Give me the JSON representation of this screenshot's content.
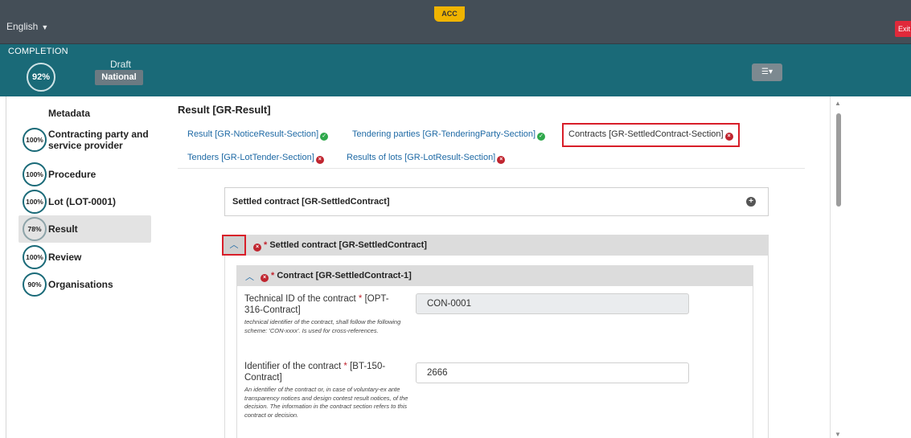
{
  "topbar": {
    "language": "English",
    "env_badge": "ACC",
    "exit_label": "Exit"
  },
  "completion": {
    "label": "COMPLETION",
    "percent": "92%",
    "status": "Draft",
    "scope": "National"
  },
  "sidebar": {
    "metadata": "Metadata",
    "items": [
      {
        "percent": "100%",
        "label": "Contracting party and service provider"
      },
      {
        "percent": "100%",
        "label": "Procedure"
      },
      {
        "percent": "100%",
        "label": "Lot (LOT-0001)"
      },
      {
        "percent": "78%",
        "label": "Result",
        "active": true
      },
      {
        "percent": "100%",
        "label": "Review"
      },
      {
        "percent": "90%",
        "label": "Organisations"
      }
    ]
  },
  "main": {
    "title": "Result [GR-Result]",
    "sections": [
      {
        "label": "Result  [GR-NoticeResult-Section]",
        "status": "ok"
      },
      {
        "label": "Tendering parties  [GR-TenderingParty-Section]",
        "status": "ok"
      },
      {
        "label": "Contracts  [GR-SettledContract-Section]",
        "status": "error"
      },
      {
        "label": "Tenders  [GR-LotTender-Section]",
        "status": "error"
      },
      {
        "label": "Results of lots  [GR-LotResult-Section]",
        "status": "error"
      }
    ],
    "settled_card_title": "Settled contract  [GR-SettledContract]",
    "settled_group_title": "Settled contract  [GR-SettledContract]",
    "contract_group_title": "Contract  [GR-SettledContract-1]",
    "fields": [
      {
        "label": "Technical ID of the contract",
        "code": "[OPT-316-Contract]",
        "help": "technical identifier of the contract, shall follow the following scheme: 'CON-xxxx'. Is used for cross-references.",
        "value": "CON-0001"
      },
      {
        "label": "Identifier of the contract",
        "code": "[BT-150-Contract]",
        "help": "An identifier of the contract or, in case of voluntary-ex ante transparency notices and design contest result notices, of the decision. The information in the contract section refers to this contract or decision.",
        "value": "2666"
      }
    ],
    "required_mark": "*"
  }
}
